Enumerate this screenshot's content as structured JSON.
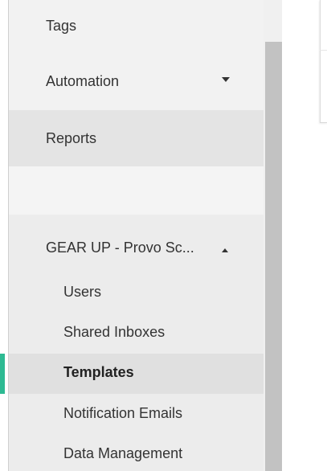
{
  "sidebar": {
    "items": [
      {
        "label": "Tags"
      },
      {
        "label": "Automation"
      },
      {
        "label": "Reports"
      }
    ],
    "org": {
      "label": "GEAR UP - Provo Sc...",
      "sub_items": [
        {
          "label": "Users"
        },
        {
          "label": "Shared Inboxes"
        },
        {
          "label": "Templates",
          "active": true
        },
        {
          "label": "Notification Emails"
        },
        {
          "label": "Data Management"
        }
      ]
    }
  },
  "colors": {
    "active_indicator": "#2dba92",
    "sidebar_bg": "#f2f2f2",
    "selected_bg": "#e0e0e0"
  },
  "icons": {
    "automation_caret": "chevron-down-icon",
    "org_caret": "chevron-up-icon"
  }
}
